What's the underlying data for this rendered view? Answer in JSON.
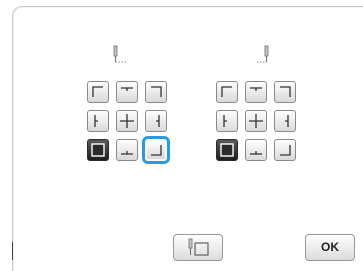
{
  "dialog": {
    "left_group_icon": "needle-start-icon",
    "right_group_icon": "needle-end-icon",
    "left_grid": {
      "rows": [
        [
          "top-left-corner-icon",
          "top-center-icon",
          "top-right-corner-icon"
        ],
        [
          "middle-left-icon",
          "center-cross-icon",
          "middle-right-icon"
        ],
        [
          "frame-outline-icon",
          "bottom-center-icon",
          "bottom-right-corner-icon"
        ]
      ],
      "selected": "bottom-right-corner-icon"
    },
    "right_grid": {
      "rows": [
        [
          "top-left-corner-icon",
          "top-center-icon",
          "top-right-corner-icon"
        ],
        [
          "middle-left-icon",
          "center-cross-icon",
          "middle-right-icon"
        ],
        [
          "frame-outline-icon",
          "bottom-center-icon",
          "bottom-right-corner-icon"
        ]
      ]
    },
    "footer": {
      "trial_button_icon": "needle-frame-icon",
      "ok_label": "OK"
    },
    "colors": {
      "selection_ring": "#2a9be0",
      "button_border": "#8a8a8a",
      "dark_button": "#2a2a2a"
    }
  }
}
